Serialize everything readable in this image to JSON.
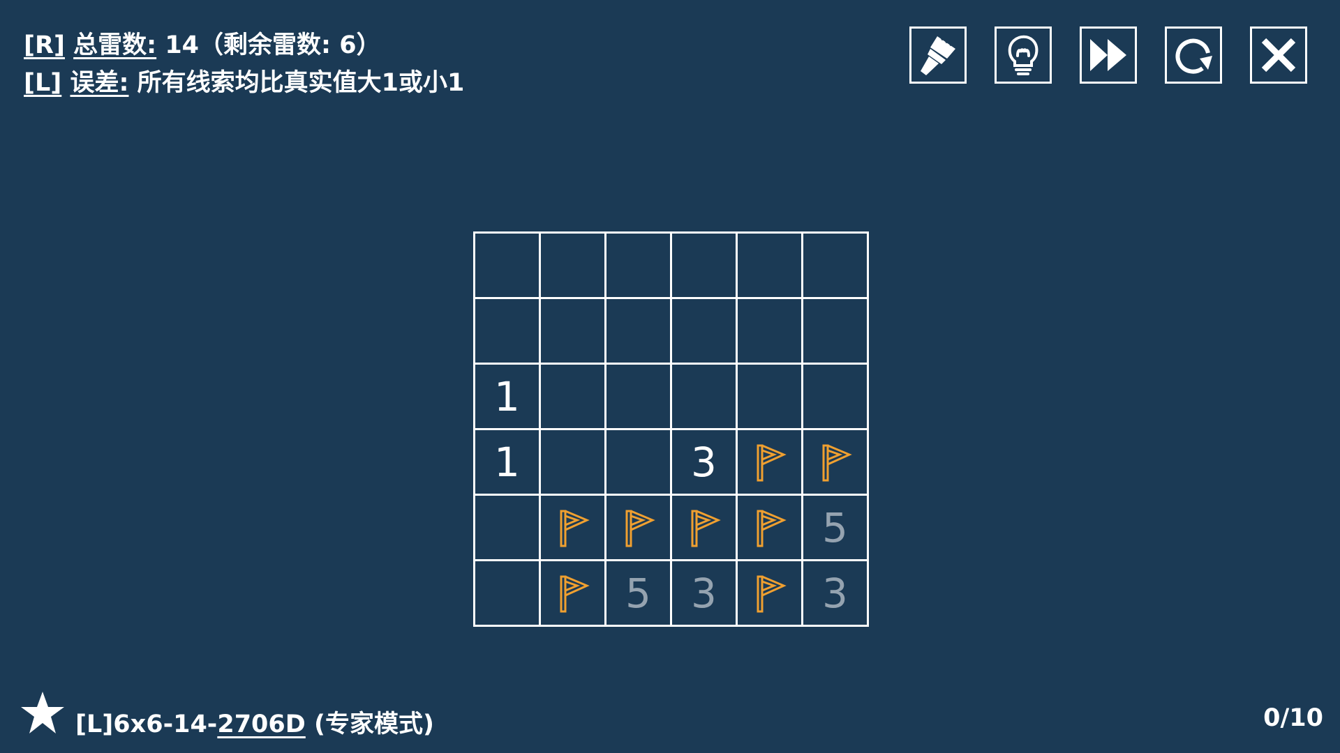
{
  "header": {
    "line1": {
      "key": "[R]",
      "label": "总雷数:",
      "value": "14（剩余雷数: 6）"
    },
    "line2": {
      "key": "[L]",
      "label": "误差:",
      "value": "所有线索均比真实值大1或小1"
    }
  },
  "toolbar": {
    "buttons": [
      {
        "name": "brush-button",
        "icon": "brush-icon"
      },
      {
        "name": "hint-button",
        "icon": "lightbulb-icon"
      },
      {
        "name": "skip-button",
        "icon": "fast-forward-icon"
      },
      {
        "name": "restart-button",
        "icon": "restart-icon"
      },
      {
        "name": "close-button",
        "icon": "close-icon"
      }
    ]
  },
  "board": {
    "rows": 6,
    "cols": 6,
    "flag_color": "#f0a030",
    "cells": [
      [
        "",
        "",
        "",
        "",
        "",
        ""
      ],
      [
        "",
        "",
        "",
        "",
        "",
        ""
      ],
      [
        "1",
        "",
        "",
        "",
        "",
        ""
      ],
      [
        "1",
        "",
        "",
        "3",
        "F",
        "F"
      ],
      [
        "",
        "F",
        "F",
        "F",
        "F",
        "5d"
      ],
      [
        "",
        "F",
        "5d",
        "3d",
        "F",
        "3d"
      ]
    ]
  },
  "footer": {
    "icon": "star-icon",
    "level_prefix": "[L]6x6-14-",
    "level_code": "2706D",
    "level_suffix": " (专家模式)",
    "progress": "0/10"
  },
  "colors": {
    "background": "#1b3a55",
    "grid": "#ffffff",
    "dim_number": "#95a3b0",
    "flag": "#f0a030"
  }
}
